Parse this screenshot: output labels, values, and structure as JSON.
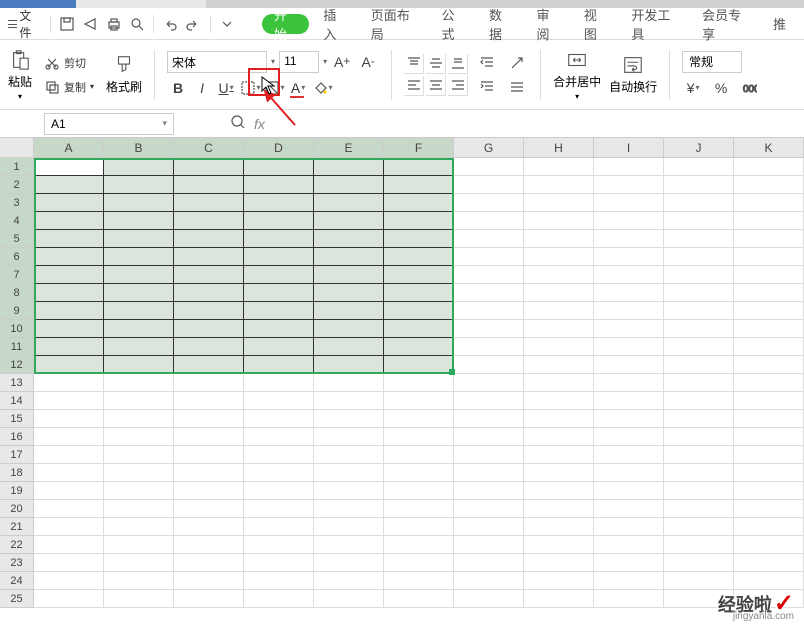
{
  "menu": {
    "file": "文件"
  },
  "tabs": {
    "start": "开始",
    "insert": "插入",
    "layout": "页面布局",
    "formula": "公式",
    "data": "数据",
    "review": "审阅",
    "view": "视图",
    "dev": "开发工具",
    "member": "会员专享",
    "rec": "推"
  },
  "ribbon": {
    "paste": "粘贴",
    "cut": "剪切",
    "copy": "复制",
    "format_painter": "格式刷",
    "font_name": "宋体",
    "font_size": "11",
    "merge": "合并居中",
    "wrap": "自动换行",
    "number_format": "常规"
  },
  "namebox": "A1",
  "columns": [
    "A",
    "B",
    "C",
    "D",
    "E",
    "F",
    "G",
    "H",
    "I",
    "J",
    "K"
  ],
  "rows_total": 25,
  "selected_cols": 6,
  "selected_rows": 12,
  "watermark": {
    "text": "经验啦",
    "url": "jingyanla.com"
  }
}
